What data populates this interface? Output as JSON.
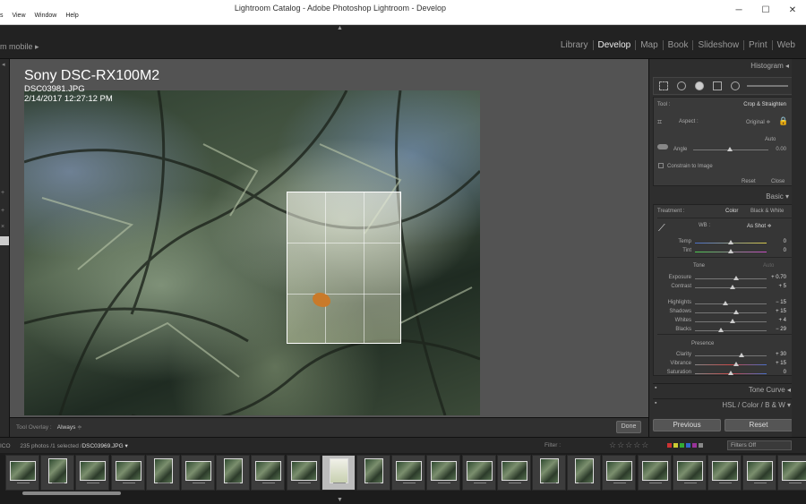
{
  "window": {
    "title": "Lightroom Catalog - Adobe Photoshop Lightroom - Develop",
    "menu": [
      "s",
      "View",
      "Window",
      "Help"
    ],
    "controls": [
      "─",
      "☐",
      "✕"
    ]
  },
  "identity": "m mobile ▸",
  "modules": [
    {
      "label": "Library",
      "active": false
    },
    {
      "label": "Develop",
      "active": true
    },
    {
      "label": "Map",
      "active": false
    },
    {
      "label": "Book",
      "active": false
    },
    {
      "label": "Slideshow",
      "active": false
    },
    {
      "label": "Print",
      "active": false
    },
    {
      "label": "Web",
      "active": false
    }
  ],
  "photo_info": {
    "camera": "Sony DSC-RX100M2",
    "filename": "DSC03981.JPG",
    "datetime": "2/14/2017 12:27:12 PM"
  },
  "toolbar": {
    "tool_overlay_label": "Tool Overlay :",
    "tool_overlay_value": "Always",
    "done_label": "Done"
  },
  "right_panel": {
    "histogram_label": "Histogram",
    "crop": {
      "tool_label": "Tool :",
      "tool_value": "Crop & Straighten",
      "aspect_label": "Aspect :",
      "aspect_value": "Original ≑",
      "auto_label": "Auto",
      "angle_label": "Angle",
      "angle_value": "0.00",
      "constrain_label": "Constrain to Image",
      "reset_label": "Reset",
      "close_label": "Close"
    },
    "basic_label": "Basic",
    "treatment_label": "Treatment :",
    "treatment_color": "Color",
    "treatment_bw": "Black & White",
    "wb_label": "WB :",
    "wb_value": "As Shot ≑",
    "tone_label": "Tone",
    "tone_auto": "Auto",
    "presence_label": "Presence",
    "sliders": [
      {
        "label": "Temp",
        "value": "0",
        "pos": 0.5
      },
      {
        "label": "Tint",
        "value": "0",
        "pos": 0.5
      },
      {
        "label": "Exposure",
        "value": "+ 0.70",
        "pos": 0.57
      },
      {
        "label": "Contrast",
        "value": "+ 5",
        "pos": 0.52
      },
      {
        "label": "Highlights",
        "value": "− 15",
        "pos": 0.43
      },
      {
        "label": "Shadows",
        "value": "+ 15",
        "pos": 0.57
      },
      {
        "label": "Whites",
        "value": "+ 4",
        "pos": 0.52
      },
      {
        "label": "Blacks",
        "value": "− 29",
        "pos": 0.36
      },
      {
        "label": "Clarity",
        "value": "+ 30",
        "pos": 0.65
      },
      {
        "label": "Vibrance",
        "value": "+ 15",
        "pos": 0.57
      },
      {
        "label": "Saturation",
        "value": "0",
        "pos": 0.5
      }
    ],
    "tone_curve_label": "Tone Curve",
    "hsl_label": "HSL  /  Color  /  B & W",
    "previous_label": "Previous",
    "reset_label": "Reset"
  },
  "filmstrip_bar": {
    "prefix": "ICO",
    "count_text": "235 photos /1 selected /",
    "selected_file": "DSC03969.JPG ▾",
    "filter_label": "Filter :",
    "stars": "☆☆☆☆☆",
    "filter_value": "Filters Off",
    "color_labels": [
      "#c33",
      "#cc3",
      "#3a3",
      "#36c",
      "#939",
      "#888"
    ]
  },
  "filmstrip": {
    "thumbs": [
      "landscape",
      "portrait",
      "landscape",
      "landscape",
      "portrait",
      "landscape",
      "portrait",
      "landscape",
      "landscape",
      "selected",
      "portrait",
      "landscape",
      "landscape",
      "landscape",
      "landscape",
      "portrait",
      "portrait",
      "landscape",
      "landscape",
      "landscape",
      "landscape",
      "landscape",
      "landscape"
    ]
  }
}
